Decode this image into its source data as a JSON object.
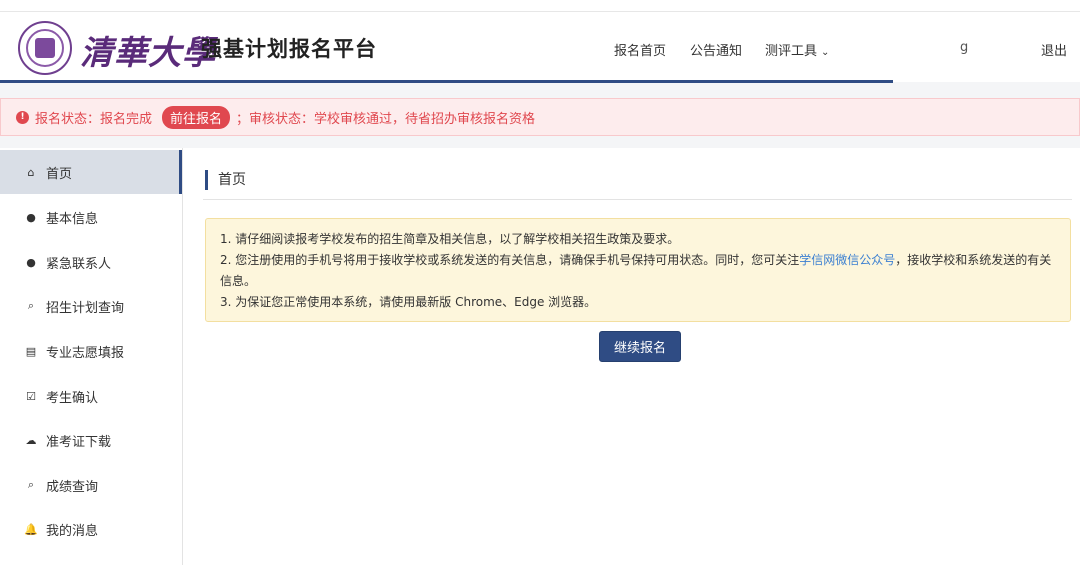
{
  "header": {
    "brand": "清華大學",
    "platform_title": "强基计划报名平台",
    "nav": [
      {
        "label": "报名首页"
      },
      {
        "label": "公告通知"
      },
      {
        "label": "测评工具",
        "dropdown": true
      }
    ],
    "user_fragment": "g",
    "logout_label": "退出"
  },
  "alert": {
    "status_text": "报名状态：报名完成",
    "pill_label": "前往报名",
    "review_text": "；审核状态：学校审核通过，待省招办审核报名资格"
  },
  "sidebar": {
    "items": [
      {
        "label": "首页",
        "icon": "home-icon",
        "glyph": "⌂"
      },
      {
        "label": "基本信息",
        "icon": "user-icon",
        "glyph": "●"
      },
      {
        "label": "紧急联系人",
        "icon": "user-icon",
        "glyph": "●"
      },
      {
        "label": "招生计划查询",
        "icon": "search-icon",
        "glyph": "⌕"
      },
      {
        "label": "专业志愿填报",
        "icon": "form-icon",
        "glyph": "▤"
      },
      {
        "label": "考生确认",
        "icon": "checkbox-icon",
        "glyph": "☑"
      },
      {
        "label": "准考证下载",
        "icon": "cloud-download-icon",
        "glyph": "☁"
      },
      {
        "label": "成绩查询",
        "icon": "search-icon",
        "glyph": "⌕"
      },
      {
        "label": "我的消息",
        "icon": "bell-icon",
        "glyph": "🔔"
      }
    ],
    "active_index": 0
  },
  "main": {
    "breadcrumb": "首页",
    "notice": {
      "line1": "1. 请仔细阅读报考学校发布的招生简章及相关信息，以了解学校相关招生政策及要求。",
      "line2_pre": "2. 您注册使用的手机号将用于接收学校或系统发送的有关信息，请确保手机号保持可用状态。同时，您可关注",
      "line2_link": "学信网微信公众号",
      "line2_post": "，接收学校和系统发送的有关信息。",
      "line3": "3. 为保证您正常使用本系统，请使用最新版 Chrome、Edge 浏览器。"
    },
    "continue_label": "继续报名"
  },
  "colors": {
    "primary": "#2f4c84",
    "alert_red": "#e0484f",
    "brand_purple": "#5a2b7a",
    "link_blue": "#3b7fd1"
  }
}
